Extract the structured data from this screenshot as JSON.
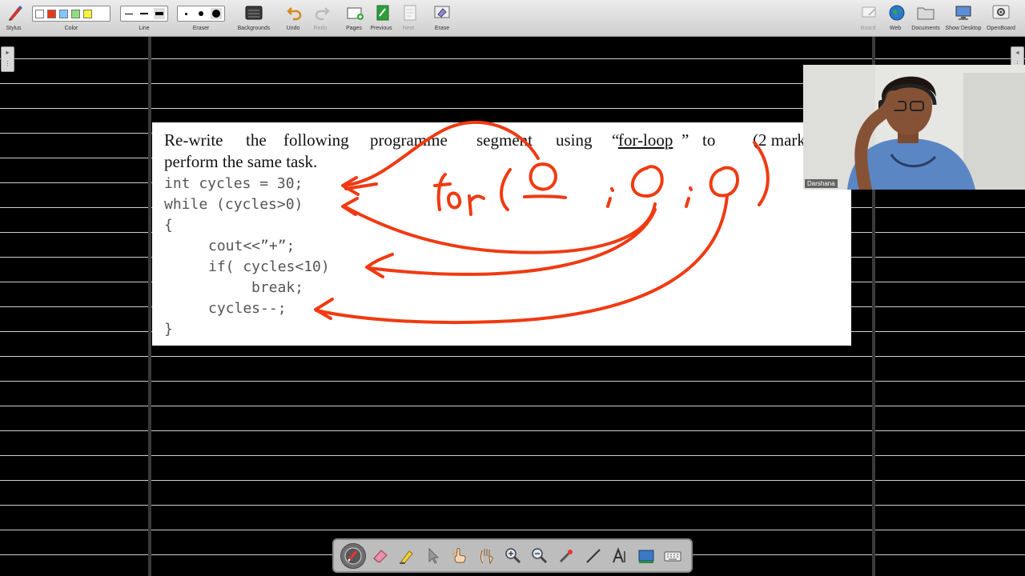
{
  "toolbar": {
    "stylus": "Stylus",
    "color": "Color",
    "line": "Line",
    "eraser": "Eraser",
    "backgrounds": "Backgrounds",
    "undo": "Undo",
    "redo": "Redo",
    "pages": "Pages",
    "previous": "Previous",
    "next": "Next",
    "erase": "Erase",
    "board": "Board",
    "web": "Web",
    "documents": "Documents",
    "show_desktop": "Show Desktop",
    "openboard": "OpenBoard",
    "colors": [
      "#ffffff",
      "#e53b1c",
      "#7fc7ff",
      "#8fe07a",
      "#f7f33a"
    ]
  },
  "question": {
    "w1": "Re-write",
    "w2": "the",
    "w3": "following",
    "w4": "programme",
    "w5": "segment",
    "w6": "using",
    "w7_open": "“",
    "w7": "for-loop",
    "w7_close": "”",
    "w8": "to",
    "marks": "(2 marks)",
    "line2": "perform the same task."
  },
  "code": {
    "l1": "int cycles = 30;",
    "l2": "while (cycles>0)",
    "l3": "{",
    "l4": "cout<<”+”;",
    "l5": "if( cycles<10)",
    "l6": "break;",
    "l7": "cycles--;",
    "l8": "}"
  },
  "webcam": {
    "name": "Darshana"
  },
  "ink_color": "#f03a12"
}
